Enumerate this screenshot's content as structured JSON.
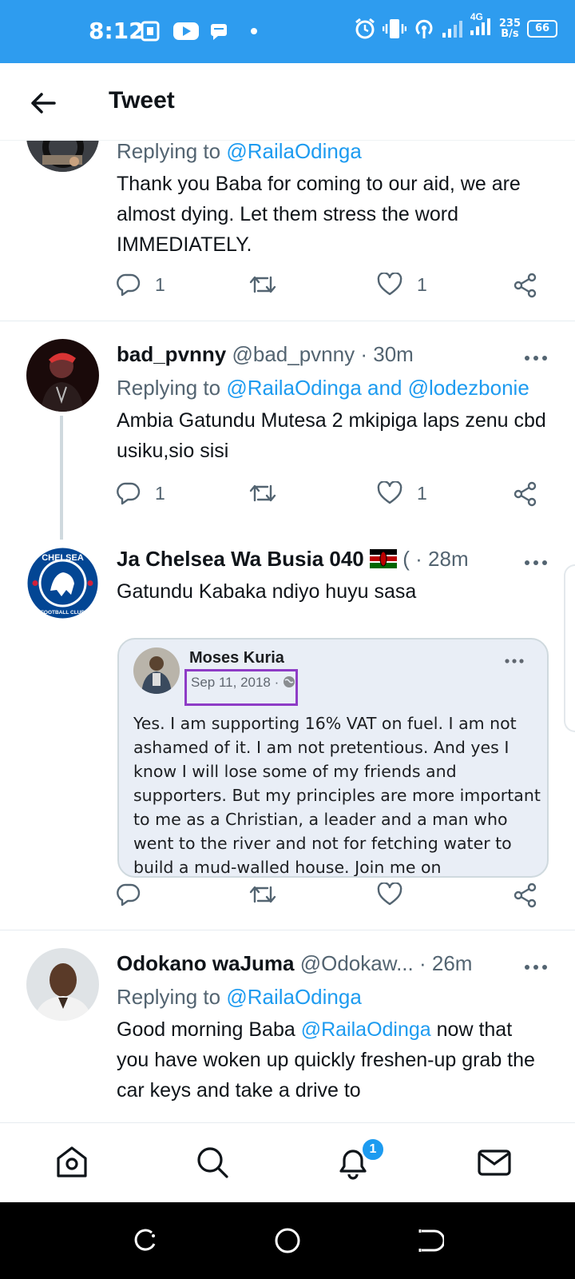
{
  "status_bar": {
    "time": "8:12",
    "network": "4G",
    "speed_value": "235",
    "speed_unit": "B/s",
    "battery": "66"
  },
  "header": {
    "title": "Tweet"
  },
  "tweets": [
    {
      "replying_prefix": "Replying to",
      "replying_to": "@RailaOdinga",
      "text": "Thank you Baba for coming to our aid, we are almost dying. Let them stress the word IMMEDIATELY.",
      "replies": "1",
      "likes": "1"
    },
    {
      "name": "bad_pvnny",
      "handle": "@bad_pvnny",
      "sep": "·",
      "time": "30m",
      "replying_prefix": "Replying to",
      "replying_to": "@RailaOdinga and @lodezbonie",
      "text": "Ambia Gatundu Mutesa 2 mkipiga laps zenu cbd usiku,sio sisi",
      "replies": "1",
      "likes": "1"
    },
    {
      "name": "Ja Chelsea Wa Busia 040",
      "handle": "(",
      "sep": "·",
      "time": "28m",
      "text": "Gatundu Kabaka ndiyo huyu sasa",
      "avatar_text": "CHELSEA",
      "avatar_subtext": "FOOTBALL CLUB",
      "quote": {
        "name": "Moses Kuria",
        "date": "Sep 11, 2018",
        "sep": "·",
        "text": "Yes. I am supporting 16% VAT on fuel. I am not ashamed of it. I am not pretentious. And yes I know I will lose some of my friends and supporters. But my principles are more important to me as a Christian, a leader and a man who went to the river and not for fetching water to build a mud-walled house. Join me on"
      }
    },
    {
      "name": "Odokano waJuma",
      "handle": "@Odokaw...",
      "sep": "·",
      "time": "26m",
      "replying_prefix": "Replying to",
      "replying_to": "@RailaOdinga",
      "text_before": "Good morning Baba",
      "mention": "@RailaOdinga",
      "text_after": "now that you have woken up quickly freshen-up grab the car keys and take a drive to"
    }
  ],
  "bottom_nav": {
    "notifications_badge": "1"
  },
  "colors": {
    "accent": "#1d9bf0",
    "status_bar": "#2e9cef",
    "text": "#0f1419",
    "muted": "#536471",
    "highlight_box": "#8e3cc6"
  }
}
